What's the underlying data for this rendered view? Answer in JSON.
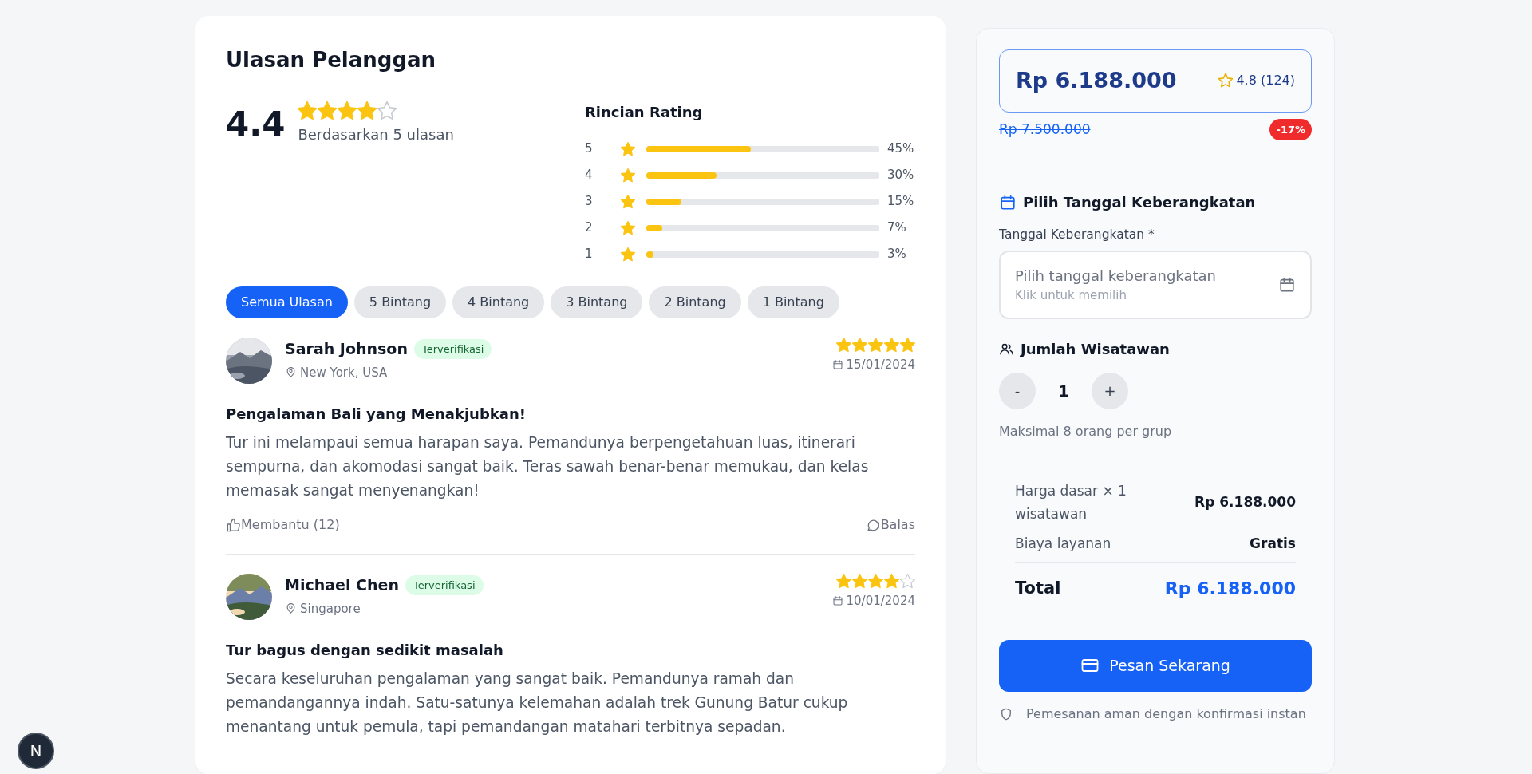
{
  "reviews_section": {
    "title": "Ulasan Pelanggan",
    "average": "4.4",
    "stars": 4,
    "based_on": "Berdasarkan 5 ulasan",
    "breakdown_title": "Rincian Rating",
    "breakdown": [
      {
        "label": "5",
        "level": 0.45,
        "percent": "45%"
      },
      {
        "label": "4",
        "level": 0.3,
        "percent": "30%"
      },
      {
        "label": "3",
        "level": 0.15,
        "percent": "15%"
      },
      {
        "label": "2",
        "level": 0.07,
        "percent": "7%"
      },
      {
        "label": "1",
        "level": 0.03,
        "percent": "3%"
      }
    ],
    "filters": [
      {
        "label": "Semua Ulasan",
        "selected": true
      },
      {
        "label": "5 Bintang",
        "selected": false
      },
      {
        "label": "4 Bintang",
        "selected": false
      },
      {
        "label": "3 Bintang",
        "selected": false
      },
      {
        "label": "2 Bintang",
        "selected": false
      },
      {
        "label": "1 Bintang",
        "selected": false
      }
    ],
    "reviews": [
      {
        "name": "Sarah Johnson",
        "badge": "Terverifikasi",
        "location": "New York, USA",
        "stars": 5,
        "date": "15/01/2024",
        "title": "Pengalaman Bali yang Menakjubkan!",
        "body": "Tur ini melampaui semua harapan saya. Pemandunya berpengetahuan luas, itinerari sempurna, dan akomodasi sangat baik. Teras sawah benar-benar memukau, dan kelas memasak sangat menyenangkan!",
        "helpful": "Membantu (12)",
        "reply": "Balas"
      },
      {
        "name": "Michael Chen",
        "badge": "Terverifikasi",
        "location": "Singapore",
        "stars": 4,
        "date": "10/01/2024",
        "title": "Tur bagus dengan sedikit masalah",
        "body": "Secara keseluruhan pengalaman yang sangat baik. Pemandunya ramah dan pemandangannya indah. Satu-satunya kelemahan adalah trek Gunung Batur cukup menantang untuk pemula, tapi pemandangan matahari terbitnya sepadan."
      }
    ]
  },
  "booking": {
    "price": "Rp 6.188.000",
    "rating": "4.8 (124)",
    "original_price": "Rp 7.500.000",
    "discount": "-17%",
    "date_section_title": "Pilih Tanggal Keberangkatan",
    "date_label": "Tanggal Keberangkatan *",
    "date_prompt": "Pilih tanggal keberangkatan",
    "date_hint": "Klik untuk memilih",
    "travelers_title": "Jumlah Wisatawan",
    "decrement": "-",
    "count": "1",
    "increment": "+",
    "travelers_note": "Maksimal 8 orang per grup",
    "summary": [
      {
        "kind": "line",
        "label": "Harga dasar × 1 wisatawan",
        "value": "Rp 6.188.000"
      },
      {
        "kind": "line",
        "label": "Biaya layanan",
        "value": "Gratis"
      },
      {
        "kind": "total",
        "label": "Total",
        "value": "Rp 6.188.000"
      }
    ],
    "book_button": "Pesan Sekarang",
    "secure_note": "Pemesanan aman dengan konfirmasi instan"
  },
  "dev_badge": "N"
}
